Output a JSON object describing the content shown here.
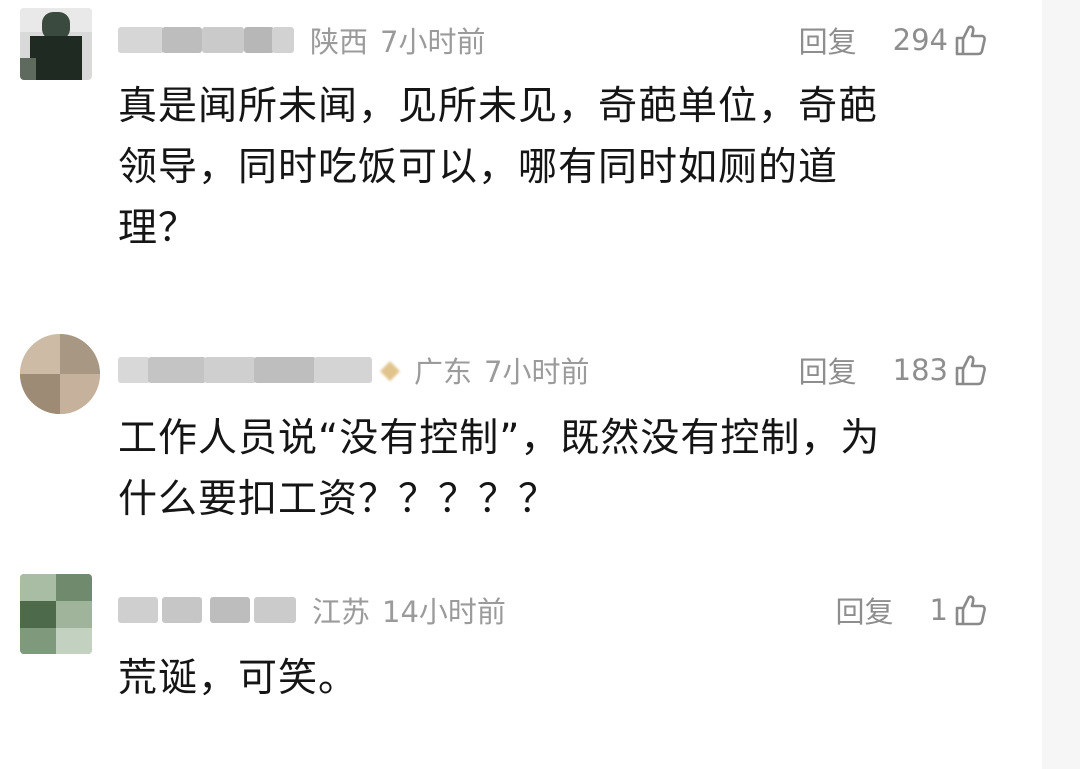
{
  "comments": [
    {
      "location": "陕西",
      "time": "7小时前",
      "reply_label": "回复",
      "likes": "294",
      "text_lines": [
        "真是闻所未闻，见所未见，奇葩单位，奇葩",
        "领导，同时吃饭可以，哪有同时如厕的道",
        "理？"
      ],
      "avatar_style": "dark-figure"
    },
    {
      "location": "广东",
      "time": "7小时前",
      "reply_label": "回复",
      "likes": "183",
      "text_lines": [
        "工作人员说“没有控制”，既然没有控制，为",
        "什么要扣工资？？？？？"
      ],
      "avatar_style": "beige-round"
    },
    {
      "location": "江苏",
      "time": "14小时前",
      "reply_label": "回复",
      "likes": "1",
      "text_lines": [
        "荒诞，可笑。"
      ],
      "avatar_style": "green-plant"
    }
  ],
  "colors": {
    "meta_text": "#9b9b9b",
    "action_text": "#8e8e8e",
    "body_text": "#151515",
    "blurred_name": "#cfcfcf"
  },
  "icons": {
    "like": "thumbs-up-icon"
  }
}
